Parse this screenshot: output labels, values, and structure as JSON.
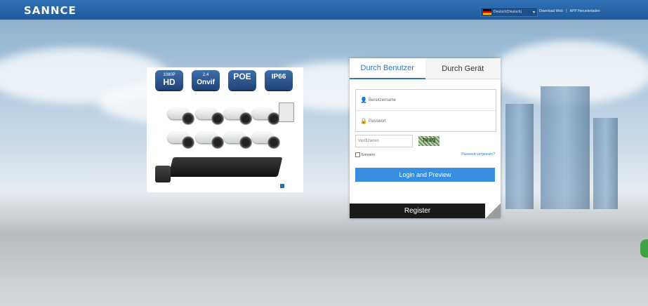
{
  "header": {
    "logo_text": "SANNCE",
    "language": "Deutsch(Deutsch)",
    "links": [
      "Download Web",
      "|",
      "APP Herunterladen"
    ]
  },
  "promo": {
    "badges": [
      {
        "top": "1080P",
        "main": "HD"
      },
      {
        "top": "2.4",
        "main": "Onvif"
      },
      {
        "top": "",
        "main": "POE"
      },
      {
        "top": "",
        "main": "IP66"
      }
    ]
  },
  "login": {
    "tab_user": "Durch Benutzer",
    "tab_device": "Durch Gerät",
    "username_placeholder": "Benutzername",
    "password_placeholder": "Passwort",
    "captcha_placeholder": "Verifizieren",
    "captcha_text": "TK8Q",
    "remember_label": "Erinnern",
    "forgot_label": "Passwort vergessen?",
    "login_button": "Login and Preview",
    "register_button": "Register"
  },
  "colors": {
    "header_blue": "#2f6fb3",
    "accent_blue": "#3a8ee0",
    "tab_blue": "#2d78c4",
    "register_bg": "#1b1b1b"
  }
}
